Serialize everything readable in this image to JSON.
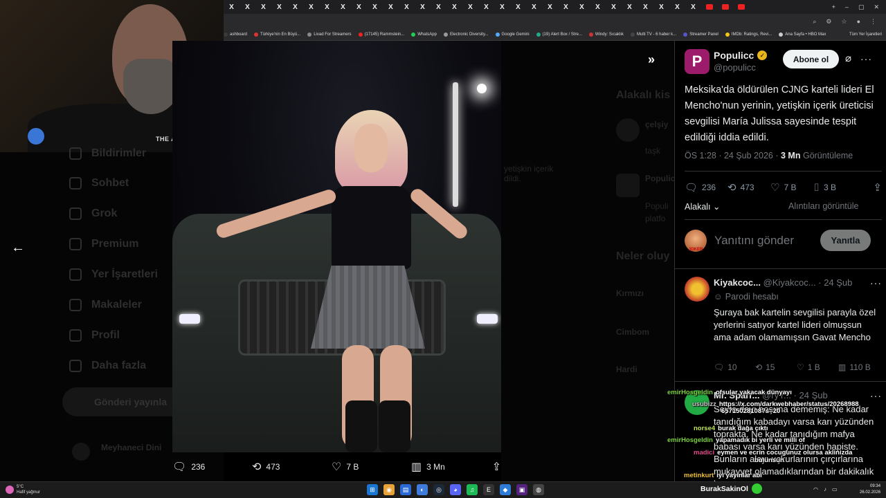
{
  "browser": {
    "tab_glyph": "X",
    "tab_count": 33,
    "bookmarks": [
      {
        "label": "ashboard",
        "color": "#3a3a3a"
      },
      {
        "label": "Türkiye'nin En Büyü...",
        "color": "#d33"
      },
      {
        "label": "Livad For Streamers",
        "color": "#888"
      },
      {
        "label": "(17145) Rammstein...",
        "color": "#e22"
      },
      {
        "label": "WhatsApp",
        "color": "#2c5"
      },
      {
        "label": "Electronic Diversity...",
        "color": "#999"
      },
      {
        "label": "Google Gemini",
        "color": "#5af"
      },
      {
        "label": "(19) Alert Box / Stre...",
        "color": "#2a8"
      },
      {
        "label": "Windy: Sıcaklık",
        "color": "#c33"
      },
      {
        "label": "Multi TV - 6 haber k...",
        "color": "#444"
      },
      {
        "label": "Streamer Panel",
        "color": "#55c"
      },
      {
        "label": "IMDb: Ratings, Revi...",
        "color": "#f5c518"
      },
      {
        "label": "Ana Sayfa • HBO Max",
        "color": "#ccc"
      }
    ],
    "all_bookmarks": "Tüm Yer İşaretleri"
  },
  "webcam": {
    "logo": "THE AYILAR"
  },
  "left_nav": {
    "items": [
      "Bildirimler",
      "Sohbet",
      "Grok",
      "Premium",
      "Yer İşaretleri",
      "Makaleler",
      "Profil",
      "Daha fazla"
    ],
    "post_button": "Gönderi yayınla",
    "account": "Meyhaneci Dini"
  },
  "photo_bar": {
    "replies": "236",
    "reposts": "473",
    "likes": "7 B",
    "views": "3 Mn"
  },
  "background_column": {
    "related_header": "Alakalı kis",
    "trends_header": "Neler oluy",
    "fragments": [
      "çelşiy",
      "taşk",
      "Populi",
      "Populic",
      "platfo",
      "Kırmızı",
      "Cimbom",
      "Hardi",
      "yetişkin içerik",
      "dildi."
    ]
  },
  "post": {
    "author_name": "Populicc",
    "author_handle": "@populicc",
    "avatar_letter": "P",
    "subscribe_label": "Abone ol",
    "text": "Meksika'da öldürülen CJNG karteli lideri El Mencho'nun yerinin, yetişkin içerik üreticisi sevgilisi María Julissa sayesinde tespit edildiği iddia edildi.",
    "time": "ÖS 1:28 · 24 Şub 2026 ·",
    "views_count": "3 Mn",
    "views_label": "Görüntüleme",
    "stats": {
      "replies": "236",
      "reposts": "473",
      "likes": "7 B",
      "bookmarks": "3 B"
    },
    "relevance": "Alakalı",
    "quotes_link": "Alıntıları görüntüle",
    "reply_placeholder": "Yanıtını gönder",
    "reply_button": "Yanıtla"
  },
  "reply1": {
    "name": "Kiyakcoc...",
    "handle": "@Kiyakcoc...",
    "date": "· 24 Şub",
    "parody": "Parodi hesabı",
    "text": "Şuraya bak kartelin sevgilisi parayla özel yerlerini satıyor kartel lideri olmuşsun ama adam olamamışsın Gavat Mencho",
    "stats": {
      "replies": "10",
      "reposts": "15",
      "likes": "1 B",
      "views": "110 B"
    }
  },
  "reply2": {
    "name": "Mr. Sparr...",
    "handle": "@ryY...",
    "date": "· 24 Şub",
    "text": "Seyfo dayı boşuna dememiş: Ne kadar tanıdığım kabadayı varsa karı yüzünden topraktа. Ne kadar tanıdığım mafya babası varsa karı yüzünden hapiste. Bunların alayı uçkurlarının çırçırlarına mukayyet olamadıklarından bir dakikalık heva"
  },
  "chat": [
    {
      "user": "emirHosgeldin",
      "text": "ofsular yakacak dünyayı",
      "color": "#7bd13a"
    },
    {
      "user": "usubizz",
      "text": "https://x.com/darkwebhaber/status/20268988",
      "color": "#ccc"
    },
    {
      "user": "",
      "text": "65715028108?s=20",
      "color": "#fff"
    },
    {
      "user": "norse4",
      "text": "burak dağa çıktı",
      "color": "#bde35a"
    },
    {
      "user": "emirHosgeldin",
      "text": "yapamadık bi yerli ve milli of",
      "color": "#7bd13a"
    },
    {
      "user": "madici",
      "text": "eymen ve ecrin cocugunuz olursa aklinizda",
      "color": "#e14a8a"
    },
    {
      "user": "",
      "text": "bulunsun",
      "color": "#fff"
    },
    {
      "user": "metinkurt",
      "text": "iyi yayınlar abi",
      "color": "#f0c030"
    }
  ],
  "taskbar": {
    "weather_temp": "5°C",
    "weather_desc": "Hafif yağmur",
    "user": "BurakSakinOl",
    "time": "09:34",
    "date": "26.02.2026"
  }
}
